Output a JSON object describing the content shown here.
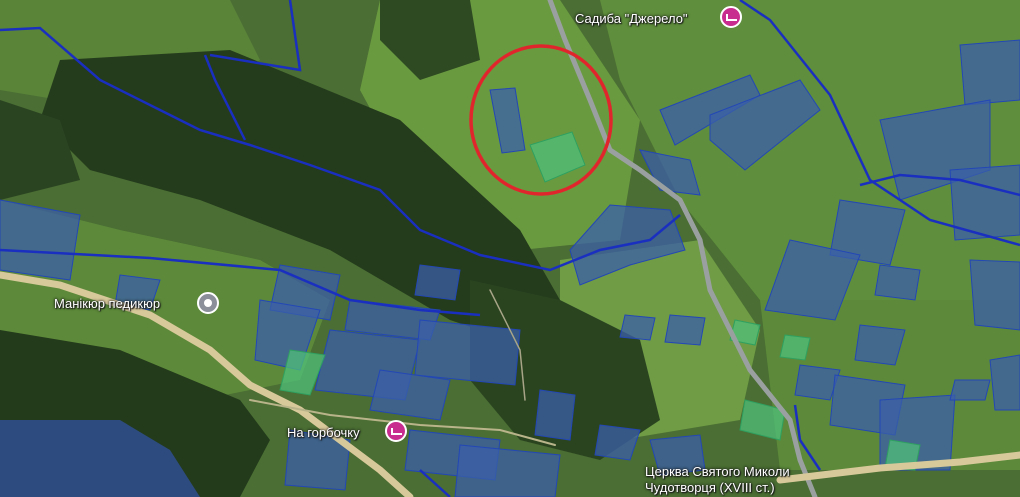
{
  "map": {
    "colors": {
      "forest": "#2c4523",
      "meadow": "#5b8a3a",
      "meadow_light": "#7aa44a",
      "parcel_fill": "#3b5fa8",
      "parcel_border": "#1f3fa0",
      "boundary_line": "#1a2fbf",
      "road": "#d8c99a",
      "highlight_fill": "#4fbf7a",
      "circle": "#e0262c",
      "poi_lodging": "#c92c8f",
      "poi_beauty": "#8a8f99"
    },
    "pois": [
      {
        "name": "Садиба \"Джерело\"",
        "icon": "lodging-icon",
        "color": "#c92c8f"
      },
      {
        "name": "Манікюр педикюр",
        "icon": "beauty-pin-icon",
        "color": "#8a8f99"
      },
      {
        "name": "На горбочку",
        "icon": "lodging-icon",
        "color": "#c92c8f"
      },
      {
        "name": "Церква Святого Миколи Чудотворця (XVIII ст.)",
        "icon": "",
        "color": ""
      }
    ]
  }
}
